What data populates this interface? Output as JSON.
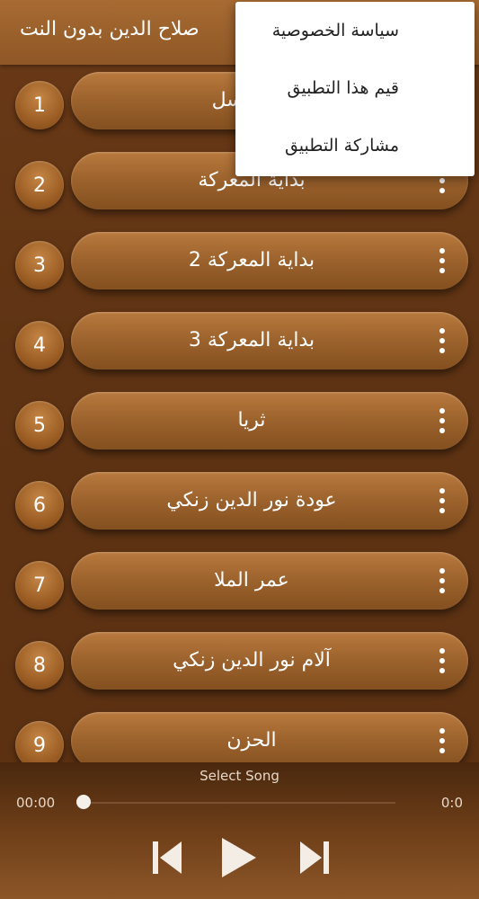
{
  "appbar": {
    "title": "صلاح الدين بدون النت"
  },
  "menu": {
    "items": [
      "سياسة الخصوصية",
      "قيم هذا التطبيق",
      "مشاركة التطبيق"
    ]
  },
  "list": {
    "items": [
      {
        "num": "1",
        "label": "المسلسل"
      },
      {
        "num": "2",
        "label": "بداية المعركة"
      },
      {
        "num": "3",
        "label": "بداية المعركة 2"
      },
      {
        "num": "4",
        "label": "بداية المعركة 3"
      },
      {
        "num": "5",
        "label": "ثريا"
      },
      {
        "num": "6",
        "label": "عودة نور الدين زنكي"
      },
      {
        "num": "7",
        "label": "عمر الملا"
      },
      {
        "num": "8",
        "label": "آلام نور الدين زنكي"
      },
      {
        "num": "9",
        "label": "الحزن"
      }
    ]
  },
  "player": {
    "song": "Select Song",
    "elapsed": "00:00",
    "duration": "0:0",
    "progress": 0
  },
  "colors": {
    "accent": "#9c5e24",
    "background": "#5e3313",
    "menu_bg": "#ffffff"
  },
  "icons": [
    "kebab-icon",
    "previous-icon",
    "play-icon",
    "next-icon"
  ]
}
